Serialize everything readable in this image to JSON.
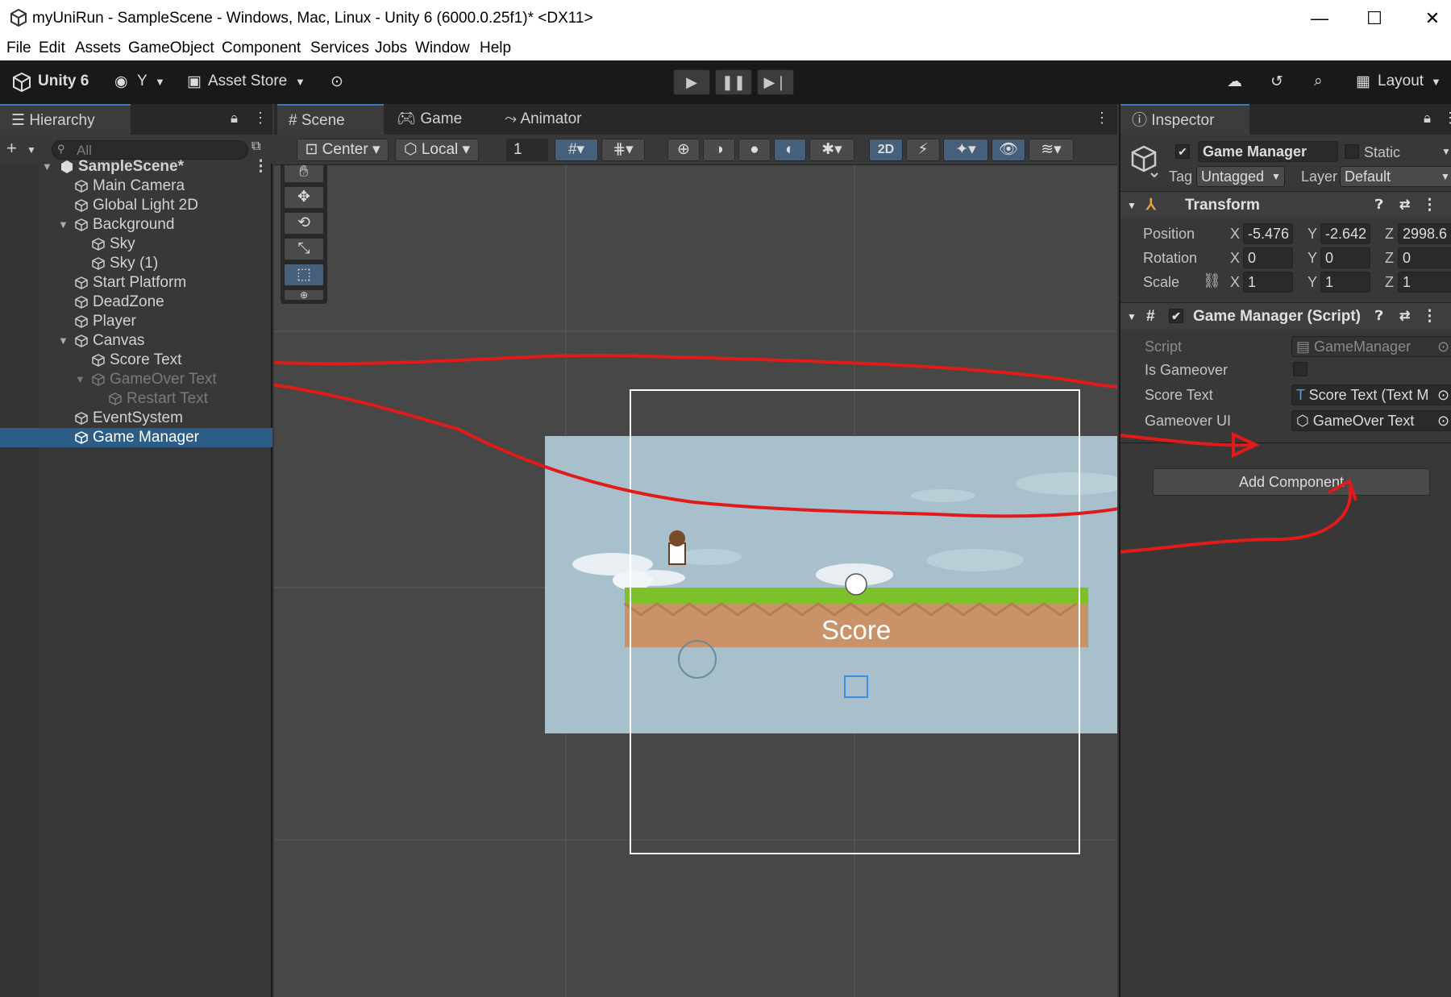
{
  "window": {
    "title": "myUniRun - SampleScene - Windows, Mac, Linux - Unity 6 (6000.0.25f1)* <DX11>",
    "min": "—",
    "max": "☐",
    "close": "✕"
  },
  "menu": [
    "File",
    "Edit",
    "Assets",
    "GameObject",
    "Component",
    "Services",
    "Jobs",
    "Window",
    "Help"
  ],
  "toolbar": {
    "unity": "Unity 6",
    "account": "Y",
    "asset_store": "Asset Store",
    "layout": "Layout"
  },
  "hierarchy": {
    "tab": "Hierarchy",
    "search_placeholder": "All",
    "items": [
      {
        "label": "SampleScene*"
      },
      {
        "label": "Main Camera"
      },
      {
        "label": "Global Light 2D"
      },
      {
        "label": "Background"
      },
      {
        "label": "Sky"
      },
      {
        "label": "Sky (1)"
      },
      {
        "label": "Start Platform"
      },
      {
        "label": "DeadZone"
      },
      {
        "label": "Player"
      },
      {
        "label": "Canvas"
      },
      {
        "label": "Score Text"
      },
      {
        "label": "GameOver Text"
      },
      {
        "label": "Restart Text"
      },
      {
        "label": "EventSystem"
      },
      {
        "label": "Game Manager"
      }
    ]
  },
  "scene": {
    "tabs": [
      "Scene",
      "Game",
      "Animator"
    ],
    "pivot": "Center",
    "space": "Local",
    "grid_snap": "1",
    "mode_2d": "2D",
    "score_label": "Score"
  },
  "inspector": {
    "tab": "Inspector",
    "object_name": "Game Manager",
    "static_label": "Static",
    "tag_label": "Tag",
    "tag_value": "Untagged",
    "layer_label": "Layer",
    "layer_value": "Default",
    "transform": {
      "title": "Transform",
      "position_label": "Position",
      "position": [
        "-5.476",
        "-2.642",
        "2998.6"
      ],
      "rotation_label": "Rotation",
      "rotation": [
        "0",
        "0",
        "0"
      ],
      "scale_label": "Scale",
      "scale": [
        "1",
        "1",
        "1"
      ],
      "axes": [
        "X",
        "Y",
        "Z"
      ]
    },
    "script_component": {
      "title": "Game Manager (Script)",
      "script_label": "Script",
      "script_value": "GameManager",
      "is_gameover_label": "Is Gameover",
      "score_text_label": "Score Text",
      "score_text_value": "Score Text (Text M",
      "gameover_ui_label": "Gameover UI",
      "gameover_ui_value": "GameOver Text"
    },
    "add_component": "Add Component"
  }
}
